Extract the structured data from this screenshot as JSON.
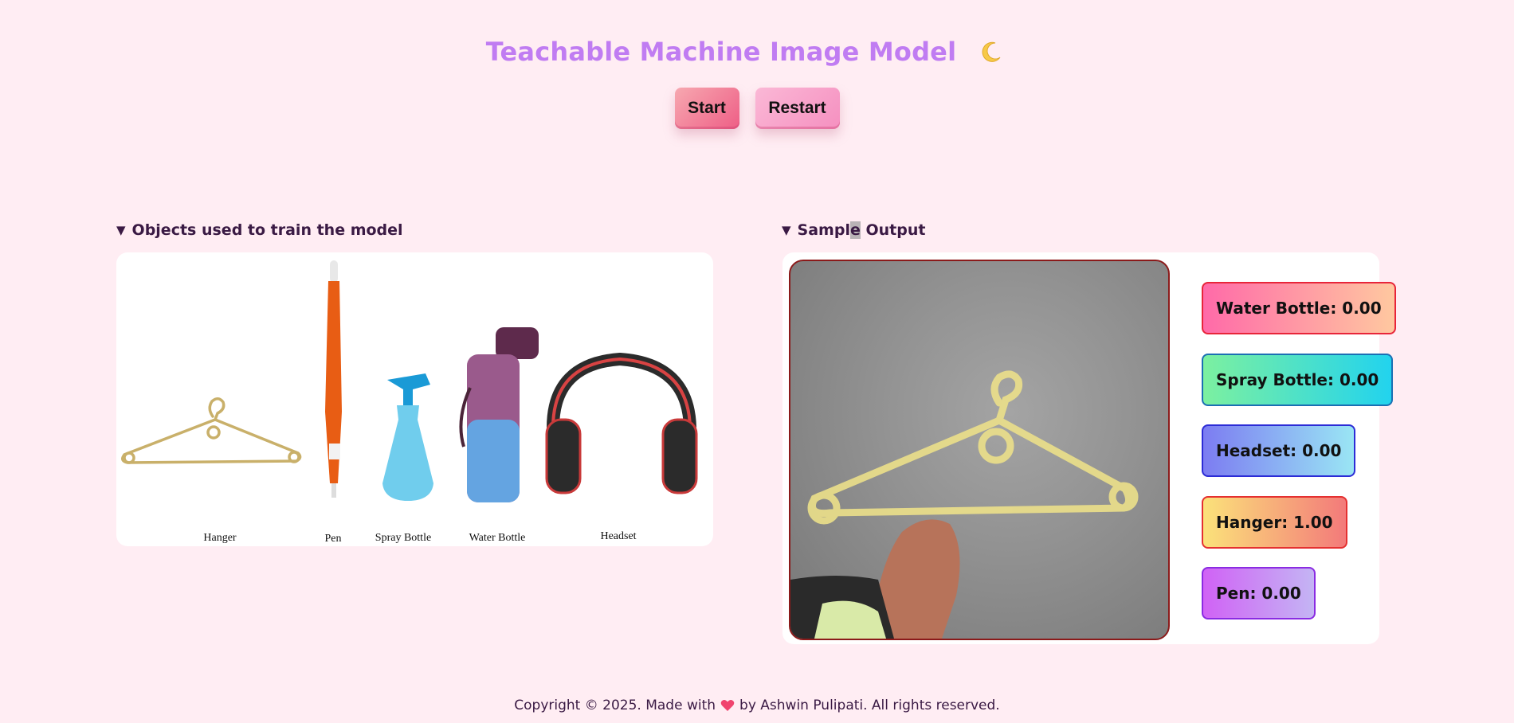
{
  "header": {
    "title": "Teachable Machine Image Model",
    "theme_icon": "crescent-moon-icon"
  },
  "controls": {
    "start_label": "Start",
    "restart_label": "Restart"
  },
  "training_section": {
    "heading": "Objects used to train the model",
    "objects": [
      "Hanger",
      "Pen",
      "Spray Bottle",
      "Water Bottle",
      "Headset"
    ]
  },
  "output_section": {
    "heading_part1": "Sampl",
    "heading_cursor": "e",
    "heading_part2": " Output",
    "predictions": [
      {
        "label": "Water Bottle: 0.00"
      },
      {
        "label": "Spray Bottle: 0.00"
      },
      {
        "label": "Headset: 0.00"
      },
      {
        "label": "Hanger: 1.00"
      },
      {
        "label": "Pen: 0.00"
      }
    ]
  },
  "footer": {
    "text_before": "Copyright © 2025. Made with",
    "heart_icon": "heart-icon",
    "text_after": "by Ashwin Pulipati. All rights reserved."
  },
  "colors": {
    "page_bg": "#ffedf3",
    "title": "#c07cf2",
    "heading_text": "#3a1a44"
  }
}
